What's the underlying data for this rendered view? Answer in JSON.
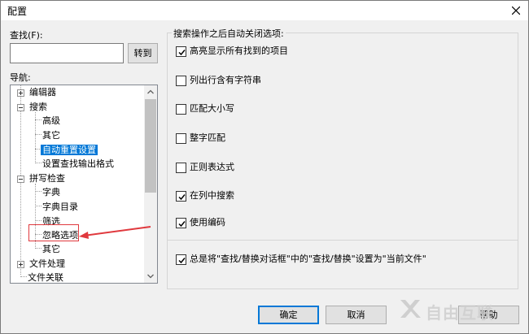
{
  "window": {
    "title": "配置"
  },
  "find": {
    "label": "查找(F):",
    "value": "",
    "goto_label": "转到"
  },
  "nav": {
    "label": "导航:",
    "items": [
      {
        "label": "编辑器",
        "expander": "plus"
      },
      {
        "label": "搜索",
        "expander": "minus"
      },
      {
        "label": "高级"
      },
      {
        "label": "其它"
      },
      {
        "label": "自动重置设置",
        "selected": true
      },
      {
        "label": "设置查找输出格式"
      },
      {
        "label": "拼写检查",
        "expander": "minus"
      },
      {
        "label": "字典"
      },
      {
        "label": "字典目录"
      },
      {
        "label": "筛选"
      },
      {
        "label": "忽略选项"
      },
      {
        "label": "其它"
      },
      {
        "label": "文件处理",
        "expander": "plus"
      },
      {
        "label": "文件关联"
      }
    ]
  },
  "options": {
    "group_title": "搜索操作之后自动关闭选项:",
    "items": [
      {
        "label": "高亮显示所有找到的项目",
        "checked": true
      },
      {
        "label": "列出行含有字符串",
        "checked": false
      },
      {
        "label": "匹配大小写",
        "checked": false
      },
      {
        "label": "整字匹配",
        "checked": false
      },
      {
        "label": "正则表达式",
        "checked": false
      },
      {
        "label": "在列中搜索",
        "checked": true
      },
      {
        "label": "使用编码",
        "checked": true
      }
    ],
    "bottom": {
      "label": "总是将\"查找/替换对话框\"中的\"查找/替换\"设置为\"当前文件\"",
      "checked": true
    }
  },
  "buttons": {
    "ok": "确定",
    "cancel": "取消",
    "help": "帮助"
  },
  "watermark": {
    "text": "自由互联"
  },
  "colors": {
    "selection": "#0078d7",
    "annotation": "#e0393e",
    "default_button": "#0078d7"
  }
}
